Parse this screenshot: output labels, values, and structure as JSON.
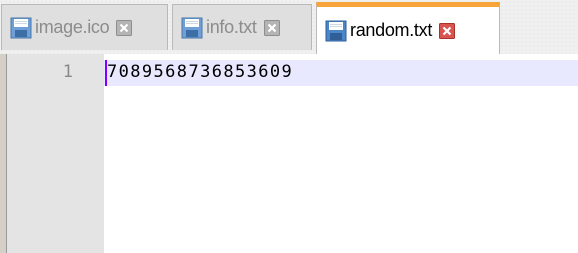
{
  "tabs": [
    {
      "label": "image.ico",
      "active": false,
      "icon": "save-icon"
    },
    {
      "label": "info.txt",
      "active": false,
      "icon": "save-icon"
    },
    {
      "label": "random.txt",
      "active": true,
      "icon": "save-icon"
    }
  ],
  "editor": {
    "lines": [
      {
        "number": "1",
        "text": "7089568736853609"
      }
    ]
  },
  "colors": {
    "active_tab_accent": "#f7a43b",
    "active_close": "#d9534f",
    "inactive_close": "#9a9a9a",
    "current_line": "#e8e8ff",
    "caret": "#8000ff",
    "save_icon": "#4a86c8"
  }
}
